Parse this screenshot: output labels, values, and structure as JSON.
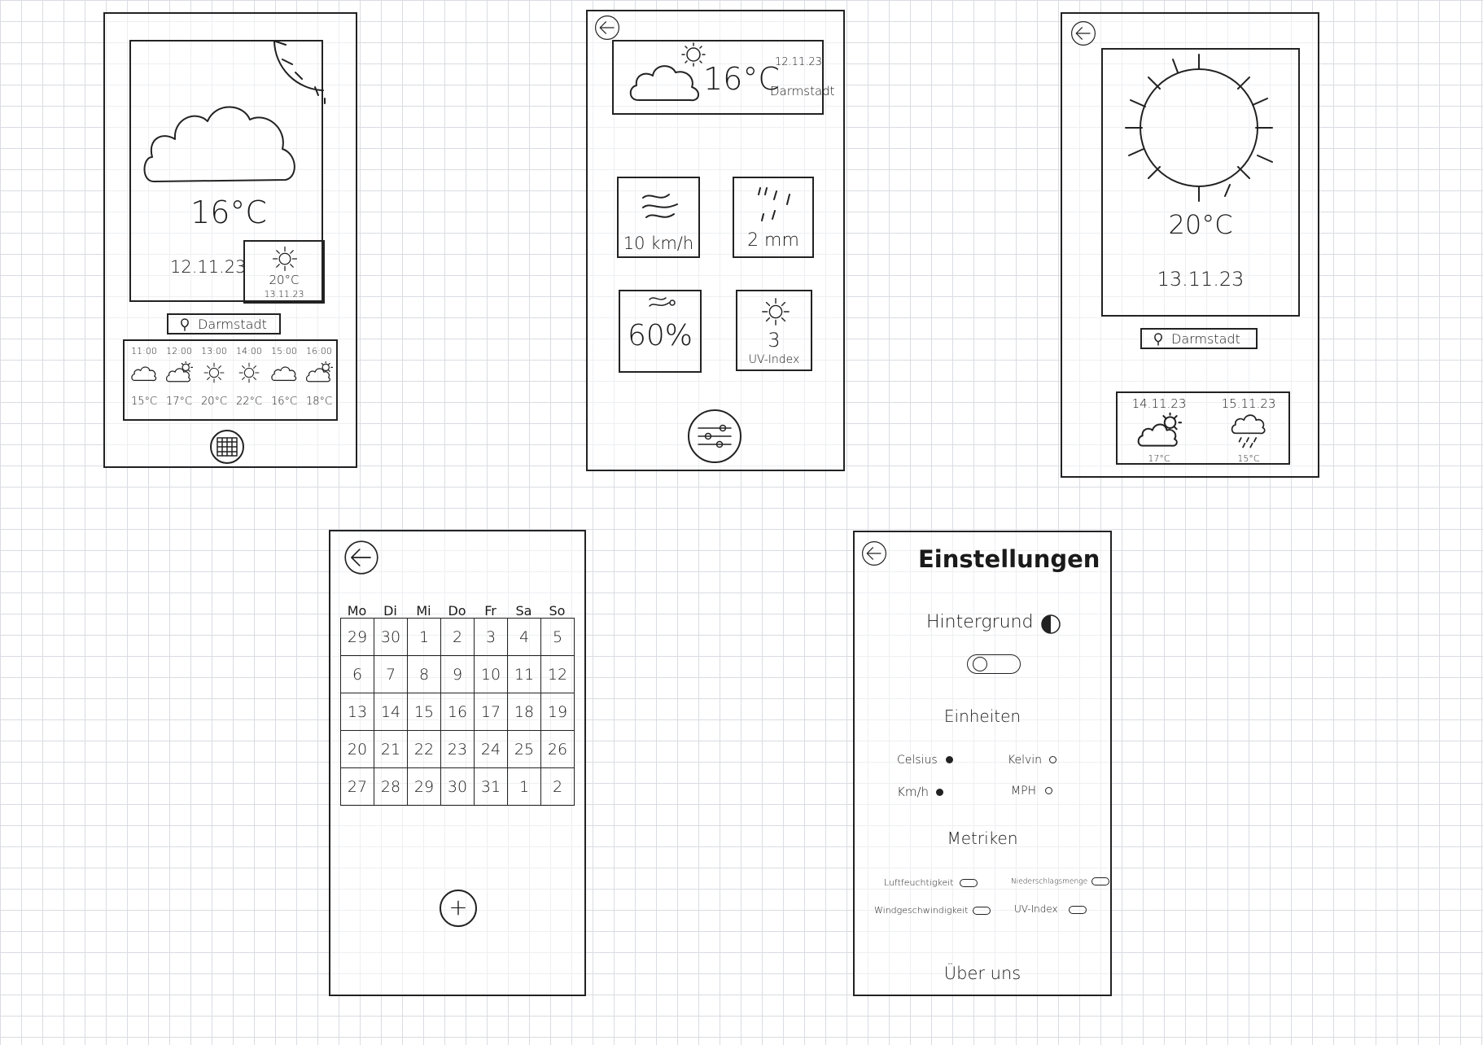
{
  "screen_home": {
    "temperature": "16°C",
    "date": "12.11.23",
    "tomorrow": {
      "temperature": "20°C",
      "date": "13.11.23"
    },
    "location": "Darmstadt",
    "hourly": [
      {
        "time": "11:00",
        "icon": "cloud-icon",
        "temp": "15°C"
      },
      {
        "time": "12:00",
        "icon": "partly-cloudy-icon",
        "temp": "17°C"
      },
      {
        "time": "13:00",
        "icon": "sun-icon",
        "temp": "20°C"
      },
      {
        "time": "14:00",
        "icon": "sun-icon",
        "temp": "22°C"
      },
      {
        "time": "15:00",
        "icon": "cloud-icon",
        "temp": "16°C"
      },
      {
        "time": "16:00",
        "icon": "partly-cloudy-icon",
        "temp": "18°C"
      }
    ],
    "calendar_button_icon": "grid-icon"
  },
  "screen_details": {
    "temperature": "16°C",
    "date": "12.11.23",
    "location": "Darmstadt",
    "metrics": {
      "wind": "10 km/h",
      "rain": "2 mm",
      "humidity": "60%",
      "uv_value": "3",
      "uv_label": "UV-Index"
    },
    "settings_button_icon": "sliders-icon"
  },
  "screen_forecast": {
    "temperature": "20°C",
    "date": "13.11.23",
    "location": "Darmstadt",
    "next_days": [
      {
        "date": "14.11.23",
        "icon": "partly-cloudy-icon",
        "temp": "17°C"
      },
      {
        "date": "15.11.23",
        "icon": "rain-icon",
        "temp": "15°C"
      }
    ]
  },
  "screen_calendar": {
    "weekdays": [
      "Mo",
      "Di",
      "Mi",
      "Do",
      "Fr",
      "Sa",
      "So"
    ],
    "weeks": [
      [
        "29",
        "30",
        "1",
        "2",
        "3",
        "4",
        "5"
      ],
      [
        "6",
        "7",
        "8",
        "9",
        "10",
        "11",
        "12"
      ],
      [
        "13",
        "14",
        "15",
        "16",
        "17",
        "18",
        "19"
      ],
      [
        "20",
        "21",
        "22",
        "23",
        "24",
        "25",
        "26"
      ],
      [
        "27",
        "28",
        "29",
        "30",
        "31",
        "1",
        "2"
      ]
    ],
    "add_button_label": "+"
  },
  "screen_settings": {
    "title": "Einstellungen",
    "background_label": "Hintergrund",
    "units_heading": "Einheiten",
    "units": [
      {
        "label": "Celsius",
        "selected": true
      },
      {
        "label": "Kelvin",
        "selected": false
      },
      {
        "label": "Km/h",
        "selected": true
      },
      {
        "label": "MPH",
        "selected": false
      }
    ],
    "metrics_heading": "Metriken",
    "metrics": [
      {
        "label": "Luftfeuchtigkeit"
      },
      {
        "label": "Niederschlagsmenge"
      },
      {
        "label": "Windgeschwindigkeit"
      },
      {
        "label": "UV-Index"
      }
    ],
    "about_label": "Über uns"
  }
}
